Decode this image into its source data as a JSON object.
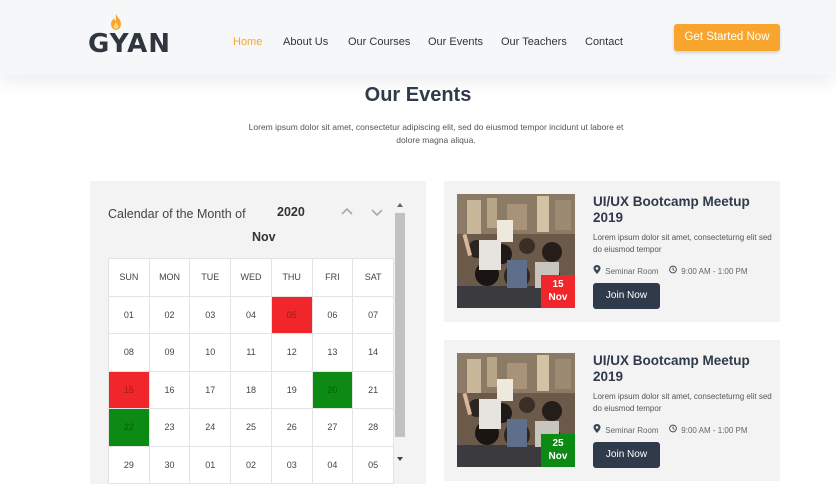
{
  "header": {
    "logo_text": "GYAN",
    "nav": [
      "Home",
      "About Us",
      "Our Courses",
      "Our Events",
      "Our Teachers",
      "Contact"
    ],
    "active_nav": "Home",
    "cta_label": "Get Started Now"
  },
  "section": {
    "title": "Our Events",
    "description": "Lorem ipsum dolor sit amet, consectetur adipiscing elit, sed do eiusmod tempor incidunt ut labore et dolore magna aliqua."
  },
  "calendar": {
    "title": "Calendar of the Month of",
    "year": "2020",
    "month": "Nov",
    "weekdays": [
      "SUN",
      "MON",
      "TUE",
      "WED",
      "THU",
      "FRI",
      "SAT"
    ],
    "weeks": [
      [
        "01",
        "02",
        "03",
        "04",
        "05",
        "06",
        "07"
      ],
      [
        "08",
        "09",
        "10",
        "11",
        "12",
        "13",
        "14"
      ],
      [
        "15",
        "16",
        "17",
        "18",
        "19",
        "20",
        "21"
      ],
      [
        "22",
        "23",
        "24",
        "25",
        "26",
        "27",
        "28"
      ],
      [
        "29",
        "30",
        "01",
        "02",
        "03",
        "04",
        "05"
      ]
    ],
    "highlights": {
      "05": "red",
      "15": "red",
      "20": "green",
      "22": "green"
    }
  },
  "events": [
    {
      "title": "UI/UX Bootcamp Meetup 2019",
      "description": "Lorem ipsum dolor sit amet, consecteturng elit sed do eiusmod tempor",
      "location": "Seminar Room",
      "time": "9:00 AM - 1:00 PM",
      "day": "15",
      "month": "Nov",
      "badge_color": "red",
      "button": "Join Now"
    },
    {
      "title": "UI/UX Bootcamp Meetup 2019",
      "description": "Lorem ipsum dolor sit amet, consecteturng elit sed do eiusmod tempor",
      "location": "Seminar Room",
      "time": "9:00 AM - 1:00 PM",
      "day": "25",
      "month": "Nov",
      "badge_color": "green",
      "button": "Join Now"
    }
  ],
  "colors": {
    "accent": "#f7a52d",
    "dark": "#2f3a4a",
    "red": "#f0262b",
    "green": "#0c8a13"
  }
}
